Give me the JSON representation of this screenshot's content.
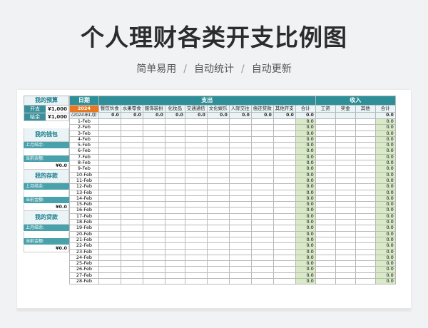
{
  "title": "个人理财各类开支比例图",
  "subtitle": [
    "简单易用",
    "自动统计",
    "自动更新"
  ],
  "subtitle_sep": "/",
  "left": {
    "budget_header": "我的预算",
    "expense_label": "开支",
    "expense_value": "¥1,000",
    "balance_label": "结余",
    "balance_value": "¥1,000",
    "wallet_header": "我的钱包",
    "last_month_label": "上月结余:",
    "current_balance_label": "当前余额:",
    "wallet_value": "¥0.0",
    "savings_header": "我的存款",
    "savings_last_label": "上月结余:",
    "savings_current_label": "当前金额:",
    "savings_value": "¥0.0",
    "loan_header": "我的贷款",
    "loan_last_label": "上月结余:",
    "loan_current_label": "当前金额:",
    "loan_value": "¥0.0"
  },
  "table": {
    "date_header": "日期",
    "expense_header": "支出",
    "income_header": "收入",
    "year": "2024",
    "year_month": "(2024年1月)",
    "expense_cols": [
      "餐饮伙食",
      "水果零食",
      "服饰装扮",
      "化妆品",
      "交通通信",
      "文化娱乐",
      "人际交往",
      "偿还贷款",
      "其他开支"
    ],
    "expense_total": "合计",
    "income_cols": [
      "工资",
      "奖金",
      "其他"
    ],
    "income_total": "合计",
    "col_totals": "0.0",
    "cell_zero": "0.0",
    "dates": [
      "1-Feb",
      "2-Feb",
      "3-Feb",
      "4-Feb",
      "5-Feb",
      "6-Feb",
      "7-Feb",
      "8-Feb",
      "9-Feb",
      "10-Feb",
      "11-Feb",
      "12-Feb",
      "13-Feb",
      "14-Feb",
      "15-Feb",
      "16-Feb",
      "17-Feb",
      "18-Feb",
      "19-Feb",
      "20-Feb",
      "21-Feb",
      "22-Feb",
      "23-Feb",
      "24-Feb",
      "25-Feb",
      "26-Feb",
      "27-Feb",
      "28-Feb"
    ]
  },
  "colors": {
    "teal": "#2f8f98",
    "orange": "#e87722",
    "green": "#d8ebc6"
  }
}
